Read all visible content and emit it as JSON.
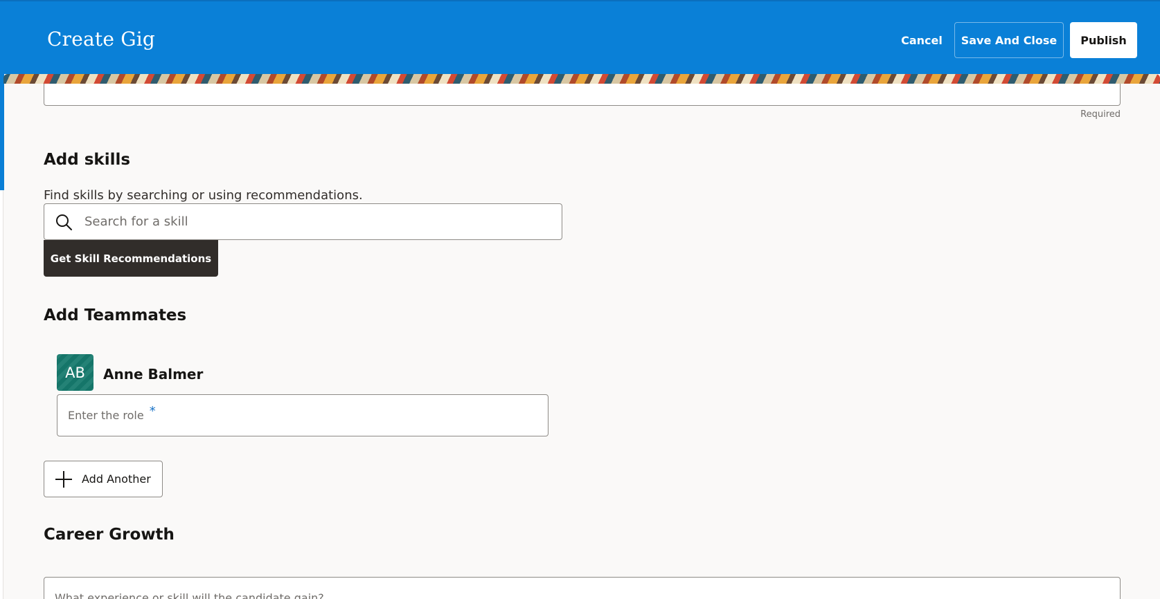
{
  "header": {
    "title": "Create Gig",
    "cancel_label": "Cancel",
    "save_close_label": "Save And Close",
    "publish_label": "Publish"
  },
  "top_field": {
    "hint": "Required"
  },
  "skills": {
    "title": "Add skills",
    "helper": "Find skills by searching or using recommendations.",
    "search_placeholder": "Search for a skill",
    "recommend_label": "Get Skill Recommendations"
  },
  "teammates": {
    "title": "Add Teammates",
    "members": [
      {
        "initials": "AB",
        "name": "Anne Balmer",
        "role_placeholder": "Enter the role",
        "required_marker": "*"
      }
    ],
    "add_another_label": "Add Another"
  },
  "career": {
    "title": "Career Growth",
    "placeholder": "What experience or skill will the candidate gain?"
  },
  "colors": {
    "header_bg": "#0a80d7",
    "primary_dark": "#312d2a",
    "avatar_bg": "#167a6d",
    "page_bg": "#faf9f8"
  }
}
